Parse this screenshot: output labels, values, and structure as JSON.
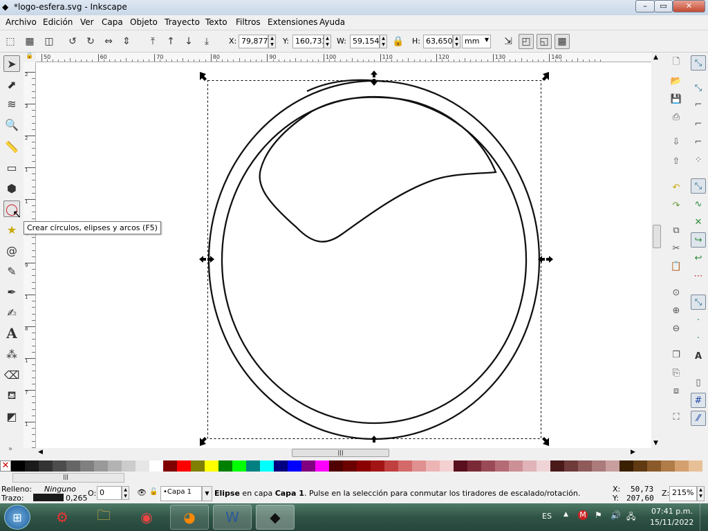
{
  "window": {
    "title": "*logo-esfera.svg - Inkscape"
  },
  "menu": [
    "Archivo",
    "Edición",
    "Ver",
    "Capa",
    "Objeto",
    "Trayecto",
    "Texto",
    "Filtros",
    "Extensiones",
    "Ayuda"
  ],
  "select_toolbar": {
    "x_label": "X:",
    "x_value": "79,877",
    "y_label": "Y:",
    "y_value": "160,733",
    "w_label": "W:",
    "w_value": "59,154",
    "h_label": "H:",
    "h_value": "63,650",
    "unit": "mm"
  },
  "ruler": {
    "h_ticks": [
      "50",
      "60",
      "70",
      "80",
      "90",
      "100",
      "110",
      "120",
      "130",
      "140"
    ],
    "v_ticks": [
      "2",
      "3",
      "2",
      "1",
      "1",
      "4",
      "9",
      "1",
      "8",
      "1",
      "7",
      "1"
    ]
  },
  "tooltip": {
    "text": "Crear círculos, elipses y arcos (F5)"
  },
  "tools": [
    "selector-tool",
    "node-tool",
    "tweak-tool",
    "zoom-tool",
    "measure-tool",
    "rectangle-tool",
    "3d-box-tool",
    "ellipse-tool",
    "star-tool",
    "spiral-tool",
    "pencil-tool",
    "pen-tool",
    "calligraphy-tool",
    "text-tool",
    "spray-tool",
    "eraser-tool",
    "paint-bucket-tool",
    "gradient-tool"
  ],
  "palette_colors": [
    "#000000",
    "#1a1a1a",
    "#333333",
    "#4d4d4d",
    "#666666",
    "#808080",
    "#999999",
    "#b3b3b3",
    "#cccccc",
    "#e6e6e6",
    "#ffffff",
    "#800000",
    "#ff0000",
    "#808000",
    "#ffff00",
    "#008000",
    "#00ff00",
    "#008080",
    "#00ffff",
    "#000080",
    "#0000ff",
    "#800080",
    "#ff00ff",
    "#500000",
    "#6b0000",
    "#8b0000",
    "#a31515",
    "#c04040",
    "#d46a6a",
    "#e09090",
    "#ecb4b4",
    "#f4d0d0",
    "#5a0f1e",
    "#7a2a37",
    "#9a4a56",
    "#b46b75",
    "#cc9096",
    "#dfb3b7",
    "#efd3d5",
    "#4a1a1a",
    "#6e3a3a",
    "#8f5a5a",
    "#ab7b7b",
    "#c89e9e",
    "#3a1f00",
    "#5f3a12",
    "#8a5a2a",
    "#b07c48",
    "#d4a070",
    "#e8c098"
  ],
  "status": {
    "fill_label": "Relleno:",
    "fill_value": "Ninguno",
    "stroke_label": "Trazo:",
    "stroke_width": "0,265",
    "opacity_label": "O:",
    "opacity_value": "0",
    "layer": "•Capa 1",
    "message_bold": "Elipse",
    "message_mid": " en capa ",
    "message_layer": "Capa 1",
    "message_rest": ". Pulse en la selección para conmutar los tiradores de escalado/rotación.",
    "cursor_x_label": "X:",
    "cursor_x": "50,73",
    "cursor_y_label": "Y:",
    "cursor_y": "207,60",
    "zoom_label": "Z:",
    "zoom_value": "215%"
  },
  "taskbar": {
    "language": "ES",
    "time": "07:41 p.m.",
    "date": "15/11/2022"
  },
  "colors": {
    "taskbar": "#2f5446",
    "canvas": "#ffffff",
    "title_gradient": "#c9d7e8"
  }
}
